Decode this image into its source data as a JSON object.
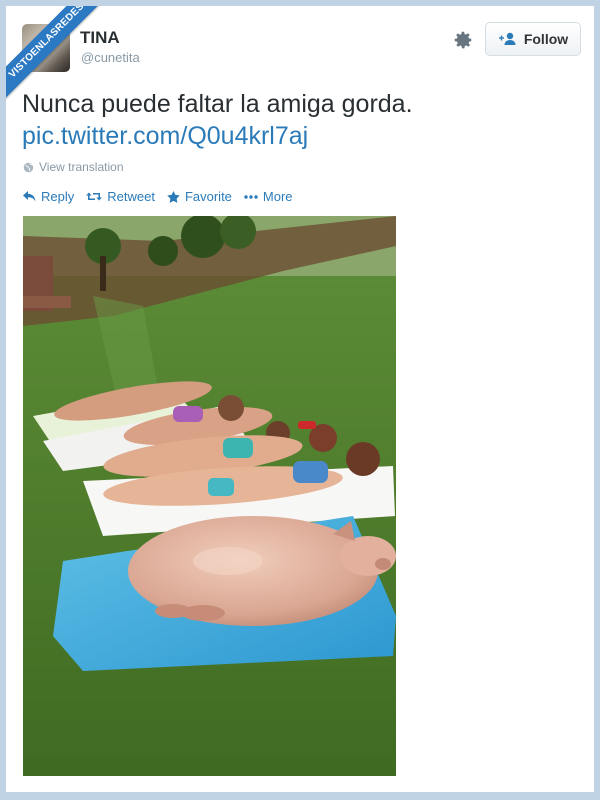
{
  "watermark": {
    "text": "VISTOENLASREDES",
    "suffix": ".com"
  },
  "user": {
    "name": "TINA",
    "handle": "@cunetita"
  },
  "header": {
    "follow_label": "Follow"
  },
  "tweet": {
    "text": "Nunca puede faltar la amiga gorda.",
    "link": "pic.twitter.com/Q0u4krl7aj",
    "translation_label": "View translation"
  },
  "actions": {
    "reply": "Reply",
    "retweet": "Retweet",
    "favorite": "Favorite",
    "more": "More"
  },
  "colors": {
    "link": "#2b7bb9",
    "muted": "#8899a6",
    "text": "#292f33",
    "ribbon": "#2b79c2"
  },
  "icons": [
    "gear-icon",
    "follow-person-icon",
    "globe-icon",
    "reply-icon",
    "retweet-icon",
    "favorite-star-icon",
    "more-dots-icon"
  ]
}
